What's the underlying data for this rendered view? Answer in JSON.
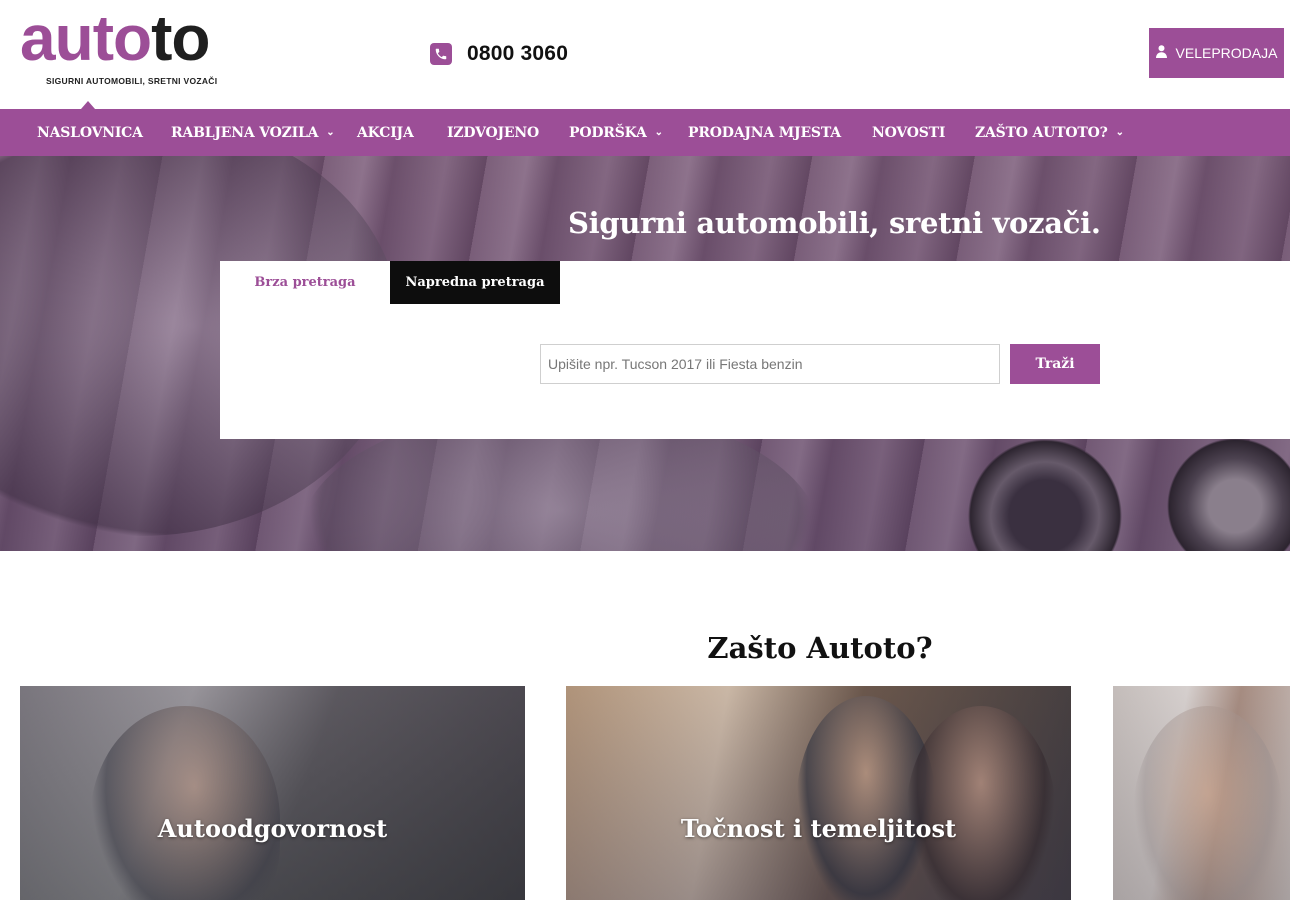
{
  "header": {
    "logo": {
      "part1": "auto",
      "part2": "to",
      "tagline": "SIGURNI AUTOMOBILI, SRETNI VOZAČI"
    },
    "phone": {
      "icon": "phone-icon",
      "number": "0800 3060"
    },
    "wholesale": {
      "icon": "user-icon",
      "label": "VELEPRODAJA"
    }
  },
  "nav": {
    "items": [
      {
        "label": "NASLOVNICA",
        "active": true,
        "dropdown": false
      },
      {
        "label": "RABLJENA VOZILA",
        "dropdown": true
      },
      {
        "label": "AKCIJA",
        "dropdown": false
      },
      {
        "label": "IZDVOJENO",
        "dropdown": false
      },
      {
        "label": "PODRŠKA",
        "dropdown": true
      },
      {
        "label": "PRODAJNA MJESTA",
        "dropdown": false
      },
      {
        "label": "NOVOSTI",
        "dropdown": false
      },
      {
        "label": "ZAŠTO AUTOTO?",
        "dropdown": true
      }
    ]
  },
  "hero": {
    "title": "Sigurni automobili, sretni vozači.",
    "tabs": {
      "quick": "Brza pretraga",
      "advanced": "Napredna pretraga"
    },
    "search": {
      "placeholder": "Upišite npr. Tucson 2017 ili Fiesta benzin",
      "value": "",
      "button": "Traži"
    }
  },
  "why": {
    "title": "Zašto Autoto?",
    "cards": [
      {
        "label": "Autoodgovornost"
      },
      {
        "label": "Točnost i temeljitost"
      },
      {
        "label": ""
      }
    ]
  },
  "colors": {
    "brand": "#9c4e97",
    "dark": "#0d0d0d"
  }
}
